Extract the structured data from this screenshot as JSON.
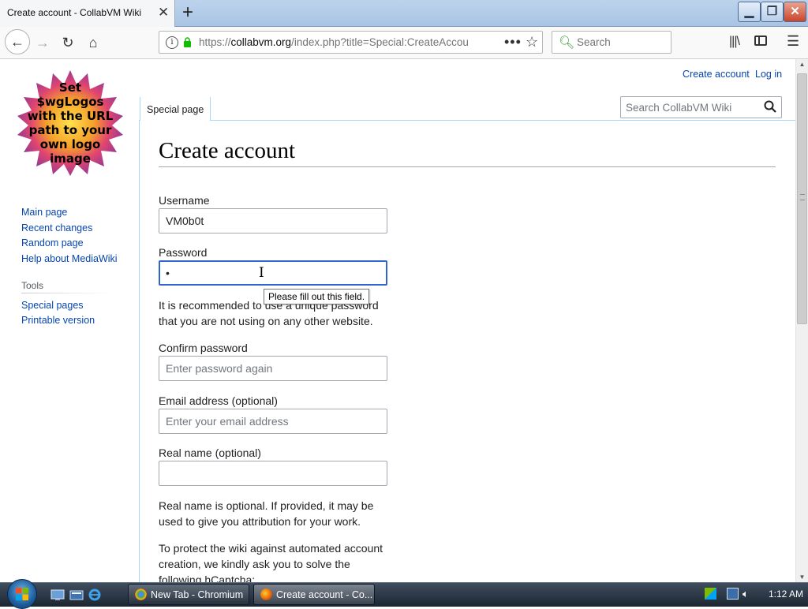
{
  "browser": {
    "tab_title": "Create account - CollabVM Wiki",
    "url_prefix": "https://",
    "url_host": "collabvm.org",
    "url_path": "/index.php?title=Special:CreateAccou",
    "search_placeholder": "Search"
  },
  "wiki": {
    "logo_text": "Set $wgLogos with the URL path to your own logo image",
    "nav_links": [
      "Main page",
      "Recent changes",
      "Random page",
      "Help about MediaWiki"
    ],
    "tools_heading": "Tools",
    "tools_links": [
      "Special pages",
      "Printable version"
    ],
    "personal": {
      "create_account": "Create account",
      "log_in": "Log in"
    },
    "special_tab": "Special page",
    "search_placeholder": "Search CollabVM Wiki"
  },
  "form": {
    "title": "Create account",
    "username_label": "Username",
    "username_value": "VM0b0t",
    "password_label": "Password",
    "password_value": "•",
    "password_hint": "It is recommended to use a unique password that you are not using on any other website.",
    "tooltip": "Please fill out this field.",
    "confirm_label": "Confirm password",
    "confirm_placeholder": "Enter password again",
    "email_label": "Email address (optional)",
    "email_placeholder": "Enter your email address",
    "realname_label": "Real name (optional)",
    "realname_value": "",
    "realname_hint": "Real name is optional. If provided, it may be used to give you attribution for your work.",
    "captcha_text": "To protect the wiki against automated account creation, we kindly ask you to solve the following hCaptcha:"
  },
  "taskbar": {
    "tasks": [
      {
        "label": "New Tab - Chromium",
        "active": false
      },
      {
        "label": "Create account - Co...",
        "active": true
      }
    ],
    "clock": "1:12 AM"
  }
}
